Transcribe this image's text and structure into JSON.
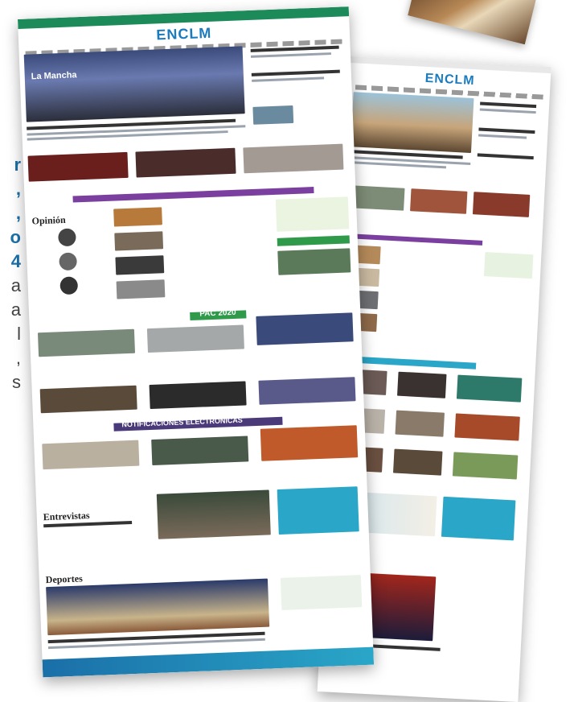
{
  "left_text": {
    "lines": [
      "r",
      ",",
      ",",
      "o",
      "4",
      "a",
      "a",
      "l",
      ",",
      "",
      "s"
    ]
  },
  "front_site": {
    "logo": "ENCLM",
    "headline_badge": "La Mancha",
    "section_opinion": "Opinión",
    "section_entrevistas": "Entrevistas",
    "section_deportes": "Deportes",
    "banner_pac": "PAC 2020",
    "banner_notificaciones": "NOTIFICACIONES ELECTRÓNICAS"
  },
  "back_site": {
    "logo": "ENCLM"
  },
  "colors": {
    "brand_green": "#1d8a5a",
    "brand_blue": "#1a7bbf",
    "accent_purple": "#7b3fa0",
    "accent_cyan": "#2aa6c8",
    "side_text_blue": "#1a6fa8"
  }
}
